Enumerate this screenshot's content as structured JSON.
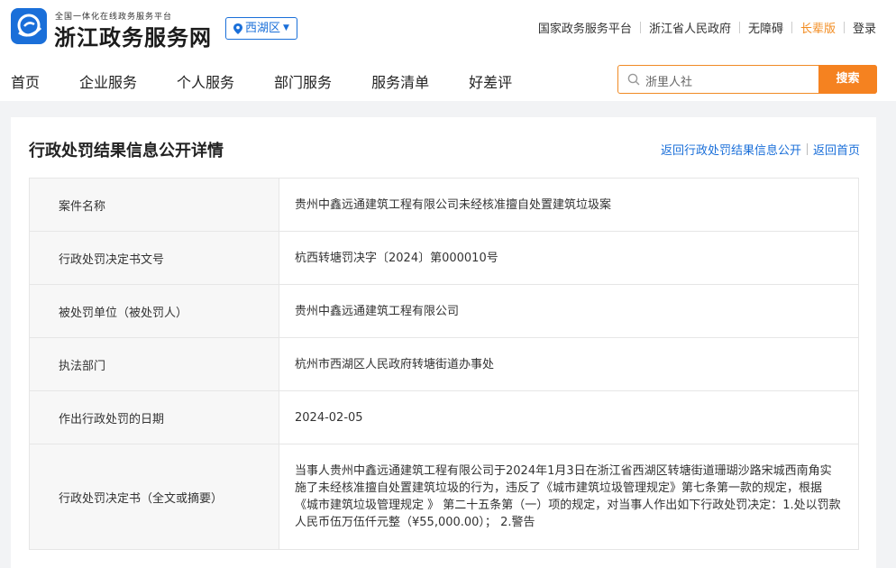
{
  "header": {
    "platform_subtitle": "全国一体化在线政务服务平台",
    "site_name": "浙江政务服务网",
    "region": "西湖区",
    "top_links": [
      "国家政务服务平台",
      "浙江省人民政府",
      "无障碍",
      "长辈版",
      "登录"
    ]
  },
  "nav": {
    "items": [
      "首页",
      "企业服务",
      "个人服务",
      "部门服务",
      "服务清单",
      "好差评"
    ]
  },
  "search": {
    "value": "浙里人社",
    "button": "搜索"
  },
  "page": {
    "title": "行政处罚结果信息公开详情",
    "back_list": "返回行政处罚结果信息公开",
    "back_home": "返回首页"
  },
  "details": [
    {
      "label": "案件名称",
      "value": "贵州中鑫远通建筑工程有限公司未经核准擅自处置建筑垃圾案"
    },
    {
      "label": "行政处罚决定书文号",
      "value": "杭西转塘罚决字〔2024〕第000010号"
    },
    {
      "label": "被处罚单位（被处罚人）",
      "value": "贵州中鑫远通建筑工程有限公司"
    },
    {
      "label": "执法部门",
      "value": "杭州市西湖区人民政府转塘街道办事处"
    },
    {
      "label": "作出行政处罚的日期",
      "value": "2024-02-05"
    },
    {
      "label": "行政处罚决定书（全文或摘要）",
      "value": "当事人贵州中鑫远通建筑工程有限公司于2024年1月3日在浙江省西湖区转塘街道珊瑚沙路宋城西南角实施了未经核准擅自处置建筑垃圾的行为，违反了《城市建筑垃圾管理规定》第七条第一款的规定，根据《城市建筑垃圾管理规定 》 第二十五条第（一）项的规定，对当事人作出如下行政处罚决定：1.处以罚款人民币伍万伍仟元整（¥55,000.00）； 2.警告"
    }
  ],
  "colors": {
    "brand_blue": "#1a6fd9",
    "accent_orange": "#f58220"
  }
}
